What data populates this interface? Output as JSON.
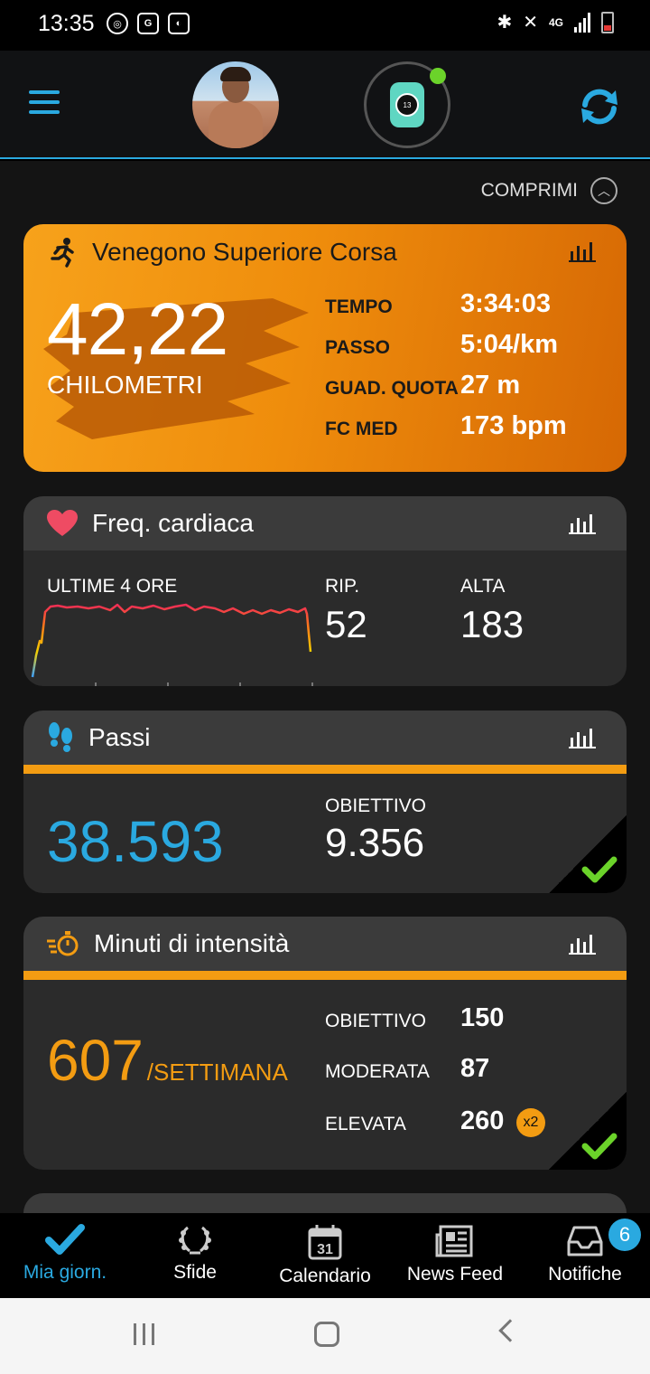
{
  "status_bar": {
    "time": "13:35",
    "network": "4G"
  },
  "header": {
    "menu_icon": "hamburger-icon",
    "sync_icon": "sync-icon"
  },
  "collapse": {
    "label": "COMPRIMI"
  },
  "activity": {
    "title": "Venegono Superiore Corsa",
    "distance": "42,22",
    "unit": "CHILOMETRI",
    "stats": [
      {
        "label": "TEMPO",
        "value": "3:34:03"
      },
      {
        "label": "PASSO",
        "value": "5:04/km"
      },
      {
        "label": "GUAD. QUOTA",
        "value": "27 m"
      },
      {
        "label": "FC MED",
        "value": "173 bpm"
      }
    ]
  },
  "heart_rate": {
    "title": "Freq. cardiaca",
    "range_label": "ULTIME 4 ORE",
    "resting_label": "RIP.",
    "resting_value": "52",
    "high_label": "ALTA",
    "high_value": "183"
  },
  "steps": {
    "title": "Passi",
    "value": "38.593",
    "goal_label": "OBIETTIVO",
    "goal_value": "9.356"
  },
  "intensity": {
    "title": "Minuti di intensità",
    "value": "607",
    "unit": "/SETTIMANA",
    "rows": [
      {
        "label": "OBIETTIVO",
        "value": "150"
      },
      {
        "label": "MODERATA",
        "value": "87"
      },
      {
        "label": "ELEVATA",
        "value": "260"
      }
    ],
    "multiplier": "x2"
  },
  "bottom_nav": [
    {
      "label": "Mia giorn.",
      "icon": "check-icon",
      "active": true
    },
    {
      "label": "Sfide",
      "icon": "laurel-icon"
    },
    {
      "label": "Calendario",
      "icon": "calendar-icon",
      "day": "31"
    },
    {
      "label": "News Feed",
      "icon": "newsfeed-icon"
    },
    {
      "label": "Notifiche",
      "icon": "inbox-icon",
      "badge": "6"
    }
  ],
  "colors": {
    "accent": "#2aa9e0",
    "orange": "#f39c12",
    "success": "#6bd32a",
    "heart": "#ef4b63"
  }
}
